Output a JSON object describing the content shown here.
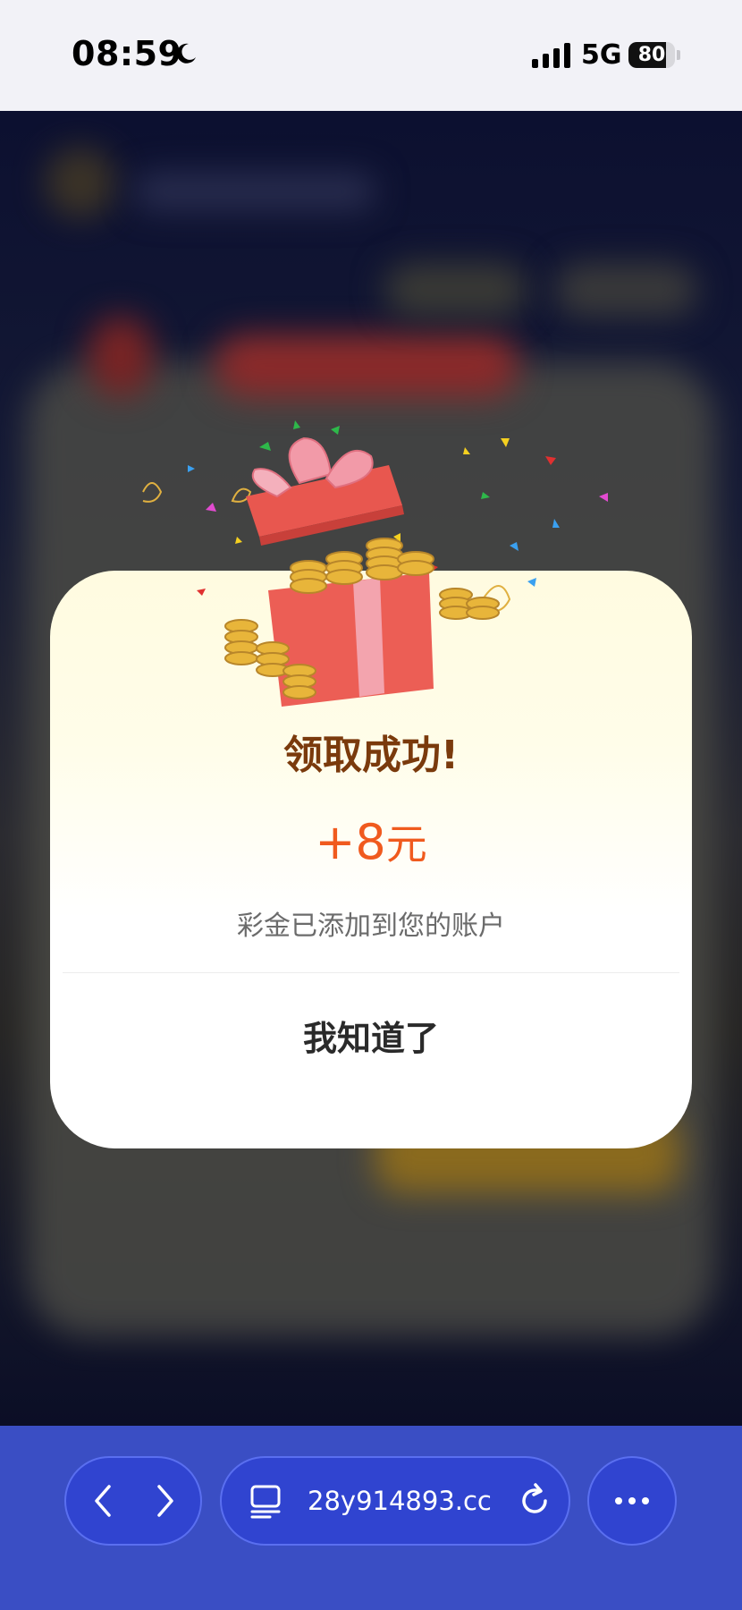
{
  "status_bar": {
    "time": "08:59",
    "network": "5G",
    "battery": "80",
    "battery_level": 0.8
  },
  "dialog": {
    "title": "领取成功!",
    "amount_value": "+8",
    "amount_unit": "元",
    "subtitle": "彩金已添加到您的账户",
    "confirm_label": "我知道了"
  },
  "browser_bar": {
    "url": "28y914893.cc",
    "icons": [
      "chevron-left-icon",
      "chevron-right-icon",
      "tabs-icon",
      "reload-icon",
      "more-icon"
    ]
  },
  "colors": {
    "accent_orange": "#f05a1e",
    "title_brown": "#7a3a0c",
    "browser_bar_bg": "#3a4ec4",
    "pill_bg": "#3044d0"
  }
}
